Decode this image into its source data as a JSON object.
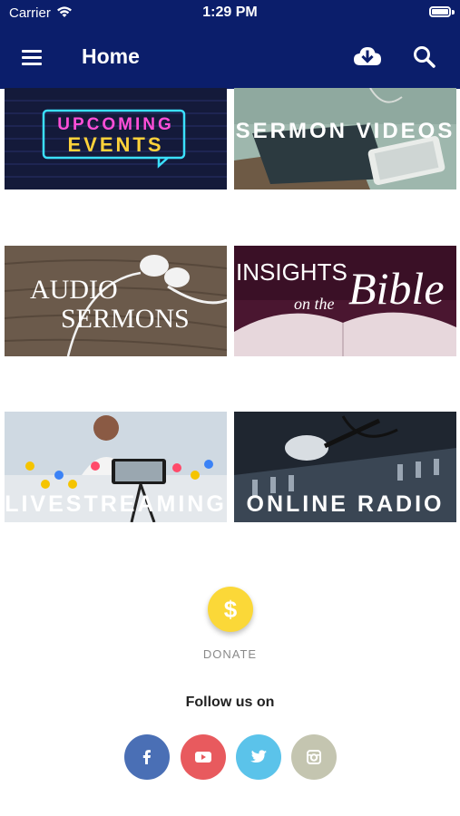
{
  "status_bar": {
    "carrier": "Carrier",
    "time": "1:29 PM"
  },
  "nav": {
    "title": "Home",
    "icons": [
      "menu-icon",
      "cloud-download-icon",
      "search-icon"
    ]
  },
  "tiles": [
    {
      "id": "upcoming-events",
      "line1": "UPCOMING",
      "line2": "EVENTS"
    },
    {
      "id": "sermon-videos",
      "label": "SERMON VIDEOS"
    },
    {
      "id": "audio-sermons",
      "line1": "AUDIO",
      "line2": "SERMONS"
    },
    {
      "id": "insights-bible",
      "line1": "INSIGHTS",
      "line2": "on the",
      "line3": "Bible"
    },
    {
      "id": "livestreaming",
      "label": "LIVESTREAMING"
    },
    {
      "id": "online-radio",
      "label": "ONLINE RADIO"
    }
  ],
  "donate": {
    "symbol": "$",
    "label": "DONATE",
    "color": "#fbd838"
  },
  "follow": {
    "title": "Follow us on",
    "networks": [
      {
        "name": "facebook",
        "icon": "facebook-icon",
        "color": "#4a6fb5"
      },
      {
        "name": "youtube",
        "icon": "youtube-icon",
        "color": "#e85a5e"
      },
      {
        "name": "twitter",
        "icon": "twitter-icon",
        "color": "#5bc3ea"
      },
      {
        "name": "instagram",
        "icon": "instagram-icon",
        "color": "#c4c5b0"
      }
    ]
  },
  "colors": {
    "header": "#0b1e6b",
    "background": "#ffffff"
  }
}
